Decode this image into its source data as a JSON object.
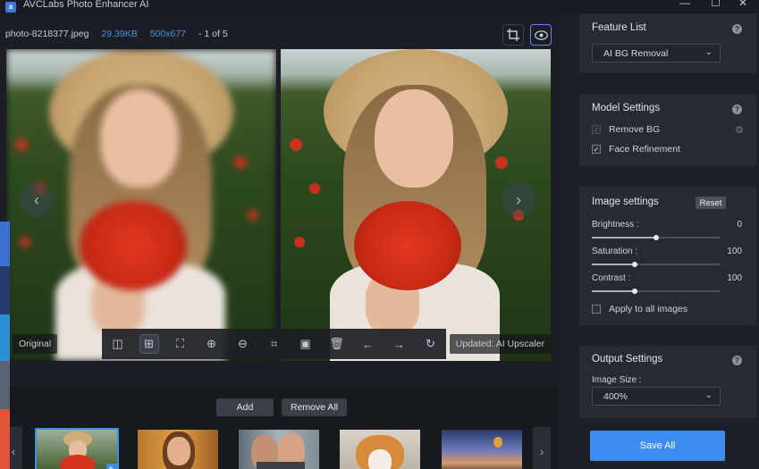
{
  "app": {
    "title": "AVCLabs Photo Enhancer AI",
    "logo_text": "a",
    "minimize_icon": "minimize-icon",
    "maximize_icon": "maximize-icon",
    "close_icon": "close-icon"
  },
  "infobar": {
    "filename": "photo-8218377.jpeg",
    "filesize": "29.39KB",
    "dimensions": "500x677",
    "page_counter": "- 1 of 5"
  },
  "viewer": {
    "left_label": "Original",
    "right_label": "Updated: AI Upscaler",
    "prev_arrow": "‹",
    "next_arrow": "›"
  },
  "toolbar": {
    "tools": [
      {
        "name": "split-view-icon",
        "glyph": "◫"
      },
      {
        "name": "compare-view-icon",
        "glyph": "⊞"
      },
      {
        "name": "fit-screen-icon",
        "glyph": "⛶"
      },
      {
        "name": "zoom-in-icon",
        "glyph": "⊕"
      },
      {
        "name": "zoom-out-icon",
        "glyph": "⊖"
      },
      {
        "name": "crop-icon",
        "glyph": "⌗"
      },
      {
        "name": "save-icon",
        "glyph": "▣"
      },
      {
        "name": "delete-icon",
        "glyph": "🗑"
      },
      {
        "name": "arrow-left-icon",
        "glyph": "←"
      },
      {
        "name": "arrow-right-icon",
        "glyph": "→"
      },
      {
        "name": "rotate-icon",
        "glyph": "↻"
      }
    ]
  },
  "bottom": {
    "add_label": "Add",
    "remove_all_label": "Remove All",
    "thumb_prev": "‹",
    "thumb_next": "›"
  },
  "panel": {
    "feature_list": {
      "title": "Feature List",
      "selected": "AI BG Removal"
    },
    "model_settings": {
      "title": "Model Settings",
      "remove_bg_label": "Remove BG",
      "remove_bg_checked": true,
      "face_refinement_label": "Face Refinement",
      "face_refinement_checked": true
    },
    "image_settings": {
      "title": "Image settings",
      "reset_label": "Reset",
      "brightness_label": "Brightness :",
      "brightness_value": "0",
      "brightness_level": 0.5,
      "saturation_label": "Saturation :",
      "saturation_value": "100",
      "saturation_level": 0.33,
      "contrast_label": "Contrast :",
      "contrast_value": "100",
      "contrast_level": 0.33,
      "apply_all_label": "Apply to all images",
      "apply_all_checked": false
    },
    "output_settings": {
      "title": "Output Settings",
      "image_size_label": "Image Size :",
      "image_size_value": "400%"
    },
    "save_all_label": "Save All"
  },
  "colors": {
    "accent": "#3d8cf0",
    "strip": [
      "#3b6fd1",
      "#263a6e",
      "#2b8fd8",
      "#5a6372",
      "#e0553a"
    ]
  }
}
